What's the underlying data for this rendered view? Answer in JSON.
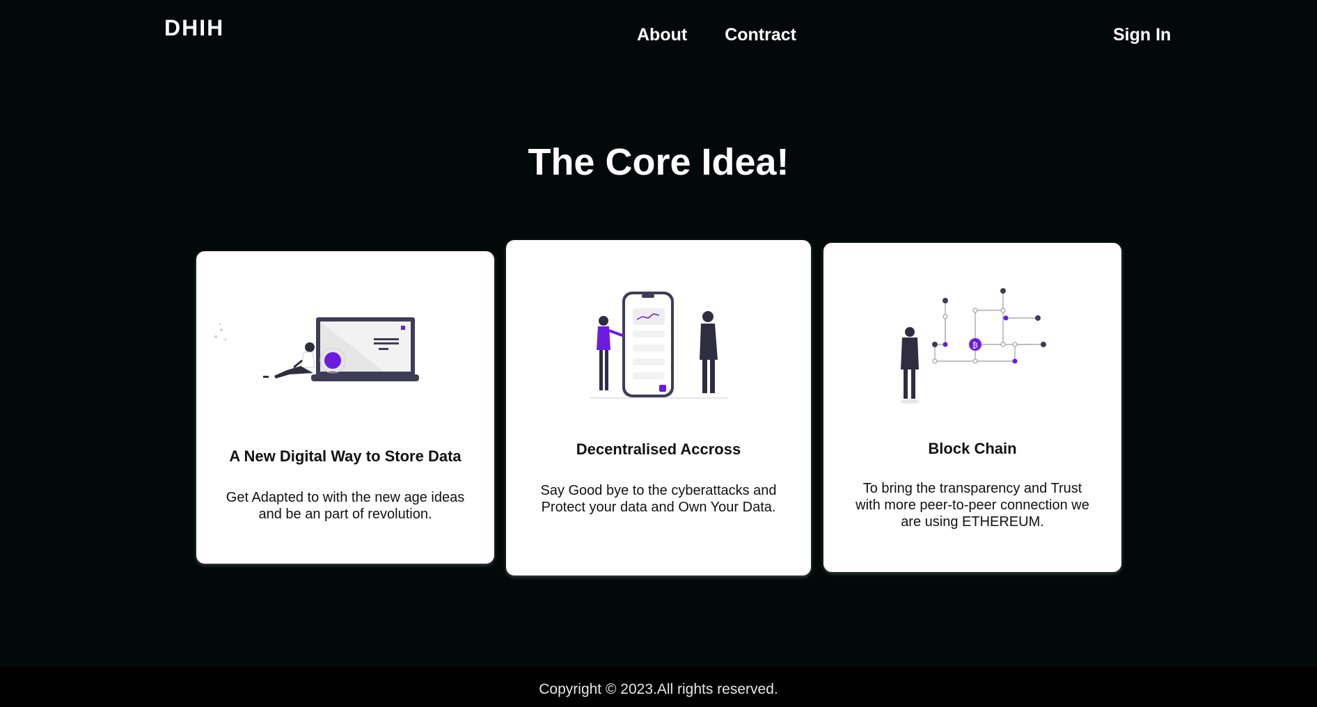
{
  "header": {
    "logo": "DHIH",
    "nav": [
      {
        "label": "About"
      },
      {
        "label": "Contract"
      }
    ],
    "signin_label": "Sign In"
  },
  "main": {
    "title": "The Core Idea!",
    "cards": [
      {
        "illustration": "laptop-person-illustration",
        "heading": "A New Digital Way to Store Data",
        "text": "Get Adapted to with the new age ideas and be an part of revolution."
      },
      {
        "illustration": "phone-people-illustration",
        "heading": "Decentralised Accross",
        "text": "Say Good bye to the cyberattacks and Protect your data and Own Your Data."
      },
      {
        "illustration": "blockchain-network-illustration",
        "heading": "Block Chain",
        "text": "To bring the transparency and Trust with more peer-to-peer connection we are using ETHEREUM."
      }
    ]
  },
  "footer": {
    "copyright": "Copyright © 2023.All rights reserved."
  },
  "colors": {
    "background": "#030808",
    "accent": "#6c1ce0",
    "card": "#ffffff",
    "dark": "#2f2e41"
  }
}
